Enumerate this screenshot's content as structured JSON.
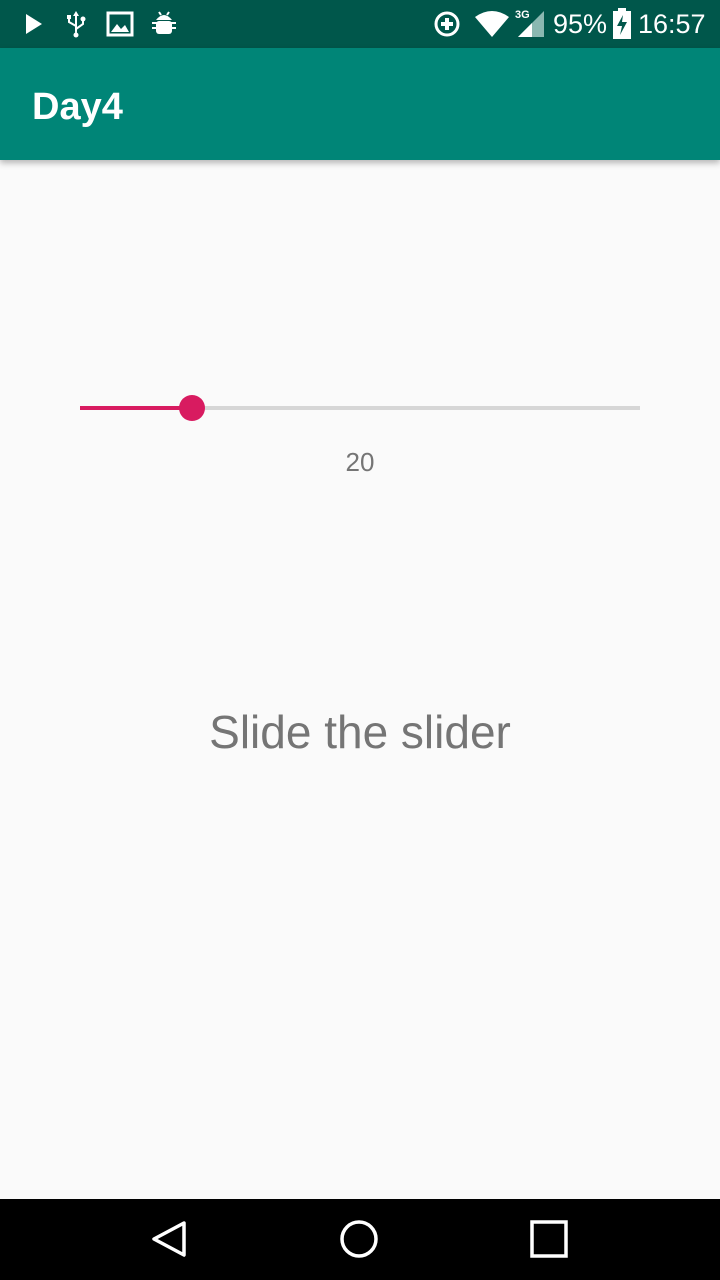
{
  "status_bar": {
    "icons_left": [
      "play-icon",
      "usb-icon",
      "image-icon",
      "android-debug-icon"
    ],
    "icons_right": [
      "data-saver-icon",
      "wifi-icon",
      "cell-signal-icon",
      "battery-charging-icon"
    ],
    "network_type": "3G",
    "battery": "95%",
    "time": "16:57"
  },
  "app_bar": {
    "title": "Day4",
    "color": "#008577"
  },
  "slider": {
    "value": "20",
    "progress_fraction": 0.2,
    "accent_color": "#d81b60",
    "track_color": "#d6d6d6"
  },
  "main": {
    "prompt": "Slide the slider"
  },
  "nav_bar": {
    "buttons": [
      "back-button",
      "home-button",
      "recents-button"
    ]
  }
}
